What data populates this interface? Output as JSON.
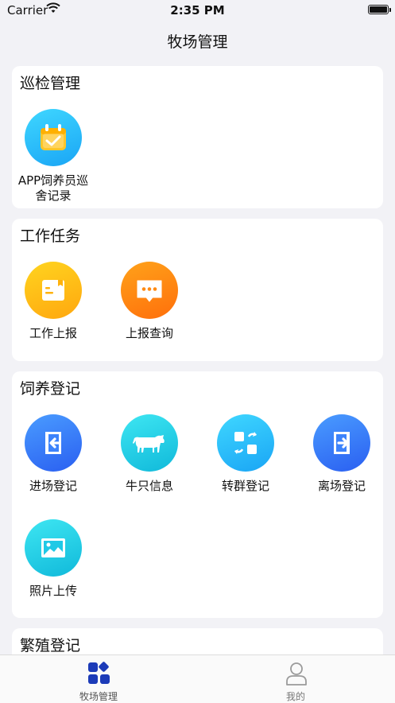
{
  "status_bar": {
    "carrier": "Carrier",
    "time": "2:35 PM"
  },
  "nav": {
    "title": "牧场管理"
  },
  "sections": [
    {
      "title": "巡检管理",
      "items": [
        {
          "label": "APP饲养员巡舍记录",
          "icon": "calendar-check-icon"
        }
      ]
    },
    {
      "title": "工作任务",
      "items": [
        {
          "label": "工作上报",
          "icon": "report-card-icon"
        },
        {
          "label": "上报查询",
          "icon": "chat-bubble-icon"
        }
      ]
    },
    {
      "title": "饲养登记",
      "items": [
        {
          "label": "进场登记",
          "icon": "enter-icon"
        },
        {
          "label": "牛只信息",
          "icon": "cow-icon"
        },
        {
          "label": "转群登记",
          "icon": "transfer-icon"
        },
        {
          "label": "离场登记",
          "icon": "exit-icon"
        },
        {
          "label": "照片上传",
          "icon": "image-icon"
        }
      ]
    },
    {
      "title": "繁殖登记",
      "items": []
    }
  ],
  "tabs": [
    {
      "label": "牧场管理",
      "active": true,
      "icon": "grid-icon"
    },
    {
      "label": "我的",
      "active": false,
      "icon": "user-icon"
    }
  ],
  "colors": {
    "active_tab": "#1c3bb8",
    "inactive_tab": "#9b9b9b"
  }
}
